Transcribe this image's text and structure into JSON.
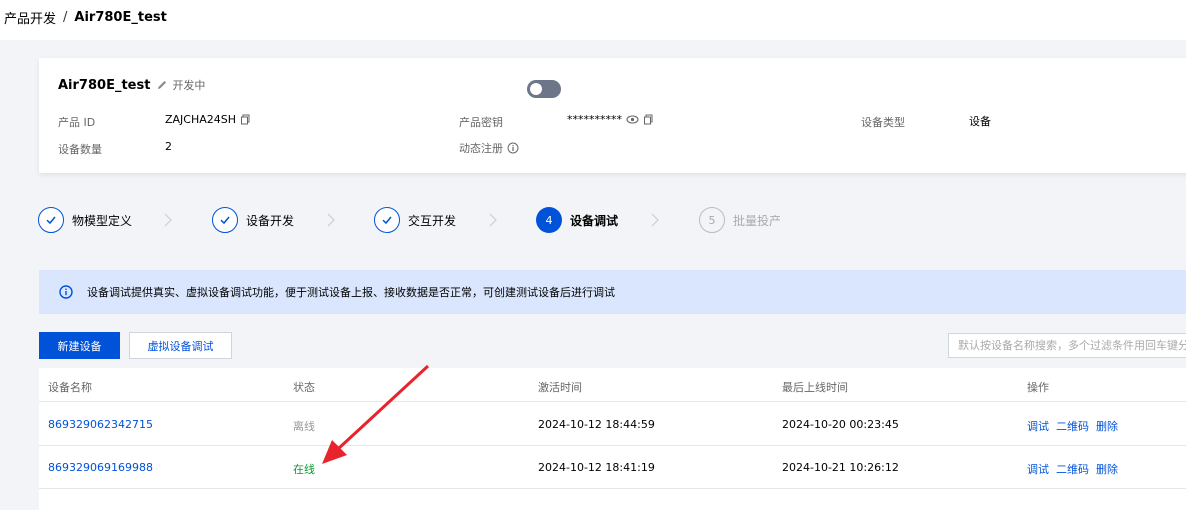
{
  "breadcrumb": {
    "parent": "产品开发",
    "separator": "/",
    "current": "Air780E_test"
  },
  "product": {
    "name": "Air780E_test",
    "status": "开发中",
    "fields": {
      "id_label": "产品 ID",
      "id_value": "ZAJCHA24SH",
      "secret_label": "产品密钥",
      "secret_value": "**********",
      "type_label": "设备类型",
      "type_value": "设备",
      "count_label": "设备数量",
      "count_value": "2",
      "dynreg_label": "动态注册"
    },
    "dynamic_registration_enabled": false
  },
  "steps": [
    {
      "num": "1",
      "label": "物模型定义",
      "state": "done"
    },
    {
      "num": "2",
      "label": "设备开发",
      "state": "done"
    },
    {
      "num": "3",
      "label": "交互开发",
      "state": "done"
    },
    {
      "num": "4",
      "label": "设备调试",
      "state": "active"
    },
    {
      "num": "5",
      "label": "批量投产",
      "state": "todo"
    }
  ],
  "notice": "设备调试提供真实、虚拟设备调试功能，便于测试设备上报、接收数据是否正常，可创建测试设备后进行调试",
  "toolbar": {
    "new_device": "新建设备",
    "virtual_debug": "虚拟设备调试",
    "search_placeholder": "默认按设备名称搜索，多个过滤条件用回车键分隔"
  },
  "table": {
    "headers": [
      "设备名称",
      "状态",
      "激活时间",
      "最后上线时间",
      "操作"
    ],
    "rows": [
      {
        "name": "869329062342715",
        "status": "离线",
        "status_type": "offline",
        "activated": "2024-10-12 18:44:59",
        "last_online": "2024-10-20 00:23:45"
      },
      {
        "name": "869329069169988",
        "status": "在线",
        "status_type": "online",
        "activated": "2024-10-12 18:41:19",
        "last_online": "2024-10-21 10:26:12"
      }
    ],
    "actions": [
      "调试",
      "二维码",
      "删除"
    ]
  },
  "colors": {
    "primary": "#0052d9",
    "online": "#0a9b32",
    "offline": "#999999",
    "annotation_arrow": "#e8232b",
    "notice_bg": "#d9e6fd"
  }
}
